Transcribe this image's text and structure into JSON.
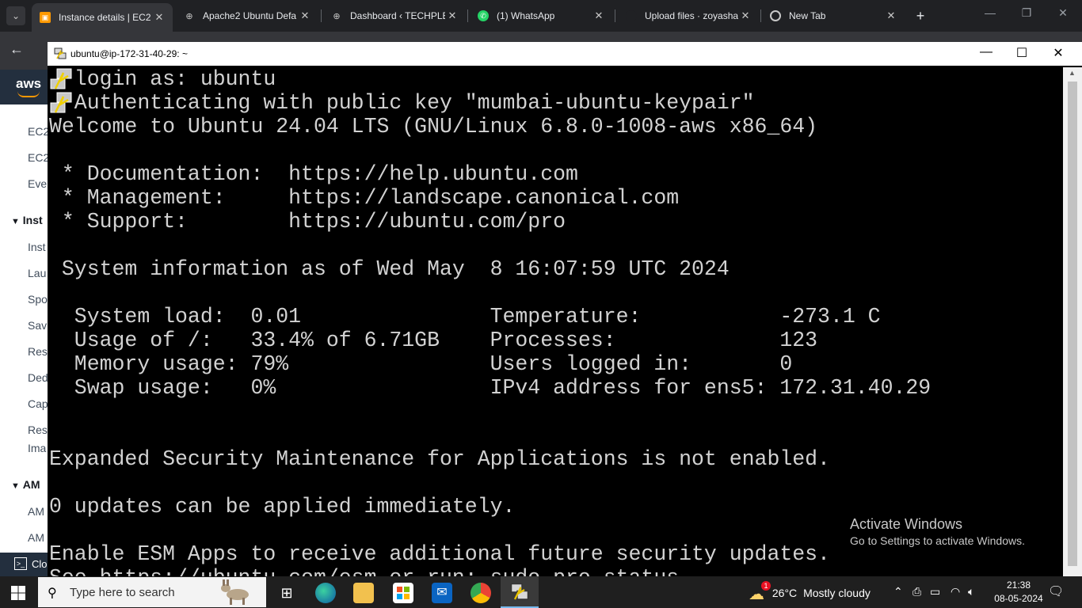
{
  "browser": {
    "tabs": [
      {
        "title": "Instance details | EC2",
        "favicon": "aws-icon",
        "active": true
      },
      {
        "title": "Apache2 Ubuntu Defa",
        "favicon": "globe-icon",
        "active": false
      },
      {
        "title": "Dashboard ‹ TECHPLE",
        "favicon": "globe-icon",
        "active": false
      },
      {
        "title": "(1) WhatsApp",
        "favicon": "whatsapp-icon",
        "active": false
      },
      {
        "title": "Upload files · zoyasha",
        "favicon": "github-icon",
        "active": false
      },
      {
        "title": "New Tab",
        "favicon": "chrome-icon",
        "active": false
      }
    ],
    "new_tab": "+"
  },
  "aws_sidebar": {
    "logo": "aws",
    "items": [
      "EC2",
      "EC2",
      "Eve",
      "Inst",
      "Inst",
      "Lau",
      "Spo",
      "Sav",
      "Res",
      "Ded",
      "Cap",
      "Res",
      "Ima",
      "AM",
      "AM"
    ],
    "cloudshell": "Clo"
  },
  "putty": {
    "title": "ubuntu@ip-172-31-40-29: ~",
    "lines": [
      "  login as: ubuntu",
      "  Authenticating with public key \"mumbai-ubuntu-keypair\"",
      "Welcome to Ubuntu 24.04 LTS (GNU/Linux 6.8.0-1008-aws x86_64)",
      "",
      " * Documentation:  https://help.ubuntu.com",
      " * Management:     https://landscape.canonical.com",
      " * Support:        https://ubuntu.com/pro",
      "",
      " System information as of Wed May  8 16:07:59 UTC 2024",
      "",
      "  System load:  0.01               Temperature:           -273.1 C",
      "  Usage of /:   33.4% of 6.71GB    Processes:             123",
      "  Memory usage: 79%                Users logged in:       0",
      "  Swap usage:   0%                 IPv4 address for ens5: 172.31.40.29",
      "",
      "",
      "Expanded Security Maintenance for Applications is not enabled.",
      "",
      "0 updates can be applied immediately.",
      "",
      "Enable ESM Apps to receive additional future security updates.",
      "See https://ubuntu.com/esm or run: sudo pro status"
    ]
  },
  "watermark": {
    "line1": "Activate Windows",
    "line2": "Go to Settings to activate Windows."
  },
  "taskbar": {
    "search_placeholder": "Type here to search",
    "weather_temp": "26°C",
    "weather_desc": "Mostly cloudy",
    "weather_badge": "1",
    "time": "21:38",
    "date": "08-05-2024"
  },
  "colors": {
    "terminal_bg": "#000000",
    "terminal_fg": "#d2d2d2",
    "chrome_bg": "#202124",
    "aws_orange": "#ff9900"
  }
}
